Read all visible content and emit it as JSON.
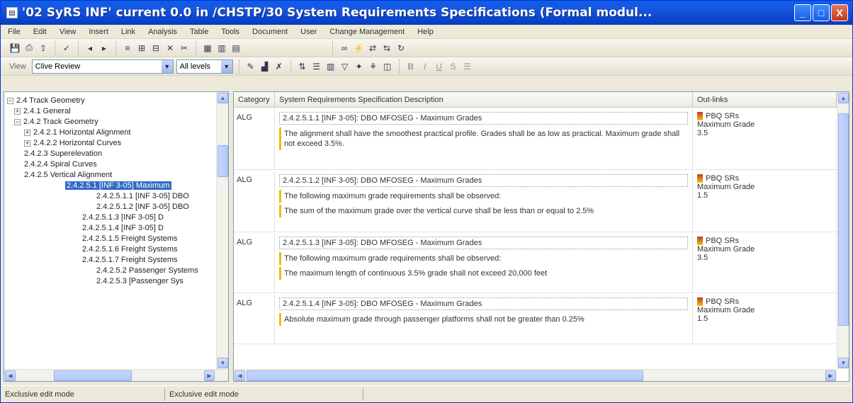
{
  "window": {
    "title": "'02 SyRS INF' current 0.0 in /CHSTP/30 System Requirements Specifications (Formal modul...",
    "buttons": {
      "minimize": "_",
      "maximize": "□",
      "close": "X"
    }
  },
  "menu": [
    "File",
    "Edit",
    "View",
    "Insert",
    "Link",
    "Analysis",
    "Table",
    "Tools",
    "Document",
    "User",
    "Change Management",
    "Help"
  ],
  "toolbar2": {
    "view_label": "View",
    "view_value": "Clive Review",
    "level_value": "All levels"
  },
  "tree": {
    "items": [
      {
        "label": "2.4 Track Geometry",
        "expander": "−"
      },
      {
        "label": "2.4.1 General",
        "expander": "+"
      },
      {
        "label": "2.4.2 Track Geometry",
        "expander": "−"
      },
      {
        "label": "2.4.2.1 Horizontal Alignment",
        "expander": "+"
      },
      {
        "label": "2.4.2.2 Horizontal Curves",
        "expander": "+"
      },
      {
        "label": "2.4.2.3 Superelevation",
        "expander": ""
      },
      {
        "label": "2.4.2.4 Spiral Curves",
        "expander": ""
      },
      {
        "label": "2.4.2.5 Vertical Alignment",
        "expander": ""
      },
      {
        "label": "2.4.2.5.1 [INF 3-05] Maximum",
        "expander": ""
      },
      {
        "label": "2.4.2.5.1.1 [INF 3-05] DBO",
        "expander": ""
      },
      {
        "label": "2.4.2.5.1.2 [INF 3-05] DBO",
        "expander": ""
      },
      {
        "label": "2.4.2.5.1.3 [INF 3-05] D",
        "expander": ""
      },
      {
        "label": "2.4.2.5.1.4 [INF 3-05] D",
        "expander": ""
      },
      {
        "label": "2.4.2.5.1.5 Freight Systems",
        "expander": ""
      },
      {
        "label": "2.4.2.5.1.6 Freight Systems",
        "expander": ""
      },
      {
        "label": "2.4.2.5.1.7 Freight Systems",
        "expander": ""
      },
      {
        "label": "2.4.2.5.2 Passenger Systems",
        "expander": ""
      },
      {
        "label": "2.4.2.5.3 [Passenger Sys",
        "expander": ""
      }
    ]
  },
  "grid": {
    "columns": [
      "Category",
      "System Requirements Specification Description",
      "Out-links"
    ],
    "rows": [
      {
        "id": "ALG",
        "heading": "2.4.2.5.1.1 [INF 3-05]: DBO MFOSEG - Maximum Grades",
        "paragraphs": [
          "The alignment shall have the smoothest practical profile. Grades shall be as low as practical. Maximum grade shall not exceed 3.5%."
        ],
        "links": "PBQ SRs\nMaximum Grade\n3.5"
      },
      {
        "id": "ALG",
        "heading": "2.4.2.5.1.2 [INF 3-05]: DBO MFOSEG - Maximum Grades",
        "paragraphs": [
          "The following maximum grade requirements shall be observed:",
          "The sum of the maximum grade over the vertical curve shall be less than or equal to 2.5%"
        ],
        "links": "PBQ SRs\nMaximum Grade\n1.5"
      },
      {
        "id": "ALG",
        "heading": "2.4.2.5.1.3 [INF 3-05]: DBO MFOSEG - Maximum Grades",
        "paragraphs": [
          "The following maximum grade requirements shall be observed:",
          "The maximum length of continuous 3.5% grade shall not exceed 20,000 feet"
        ],
        "links": "PBQ SRs\nMaximum Grade\n3.5"
      },
      {
        "id": "ALG",
        "heading": "2.4.2.5.1.4 [INF 3-05]: DBO MFOSEG - Maximum Grades",
        "paragraphs": [
          "Absolute maximum grade through passenger platforms shall not be greater than 0.25%"
        ],
        "links": "PBQ SRs\nMaximum Grade\n1.5"
      }
    ]
  },
  "status": {
    "left": "Exclusive edit mode",
    "middle": "Exclusive edit mode"
  }
}
